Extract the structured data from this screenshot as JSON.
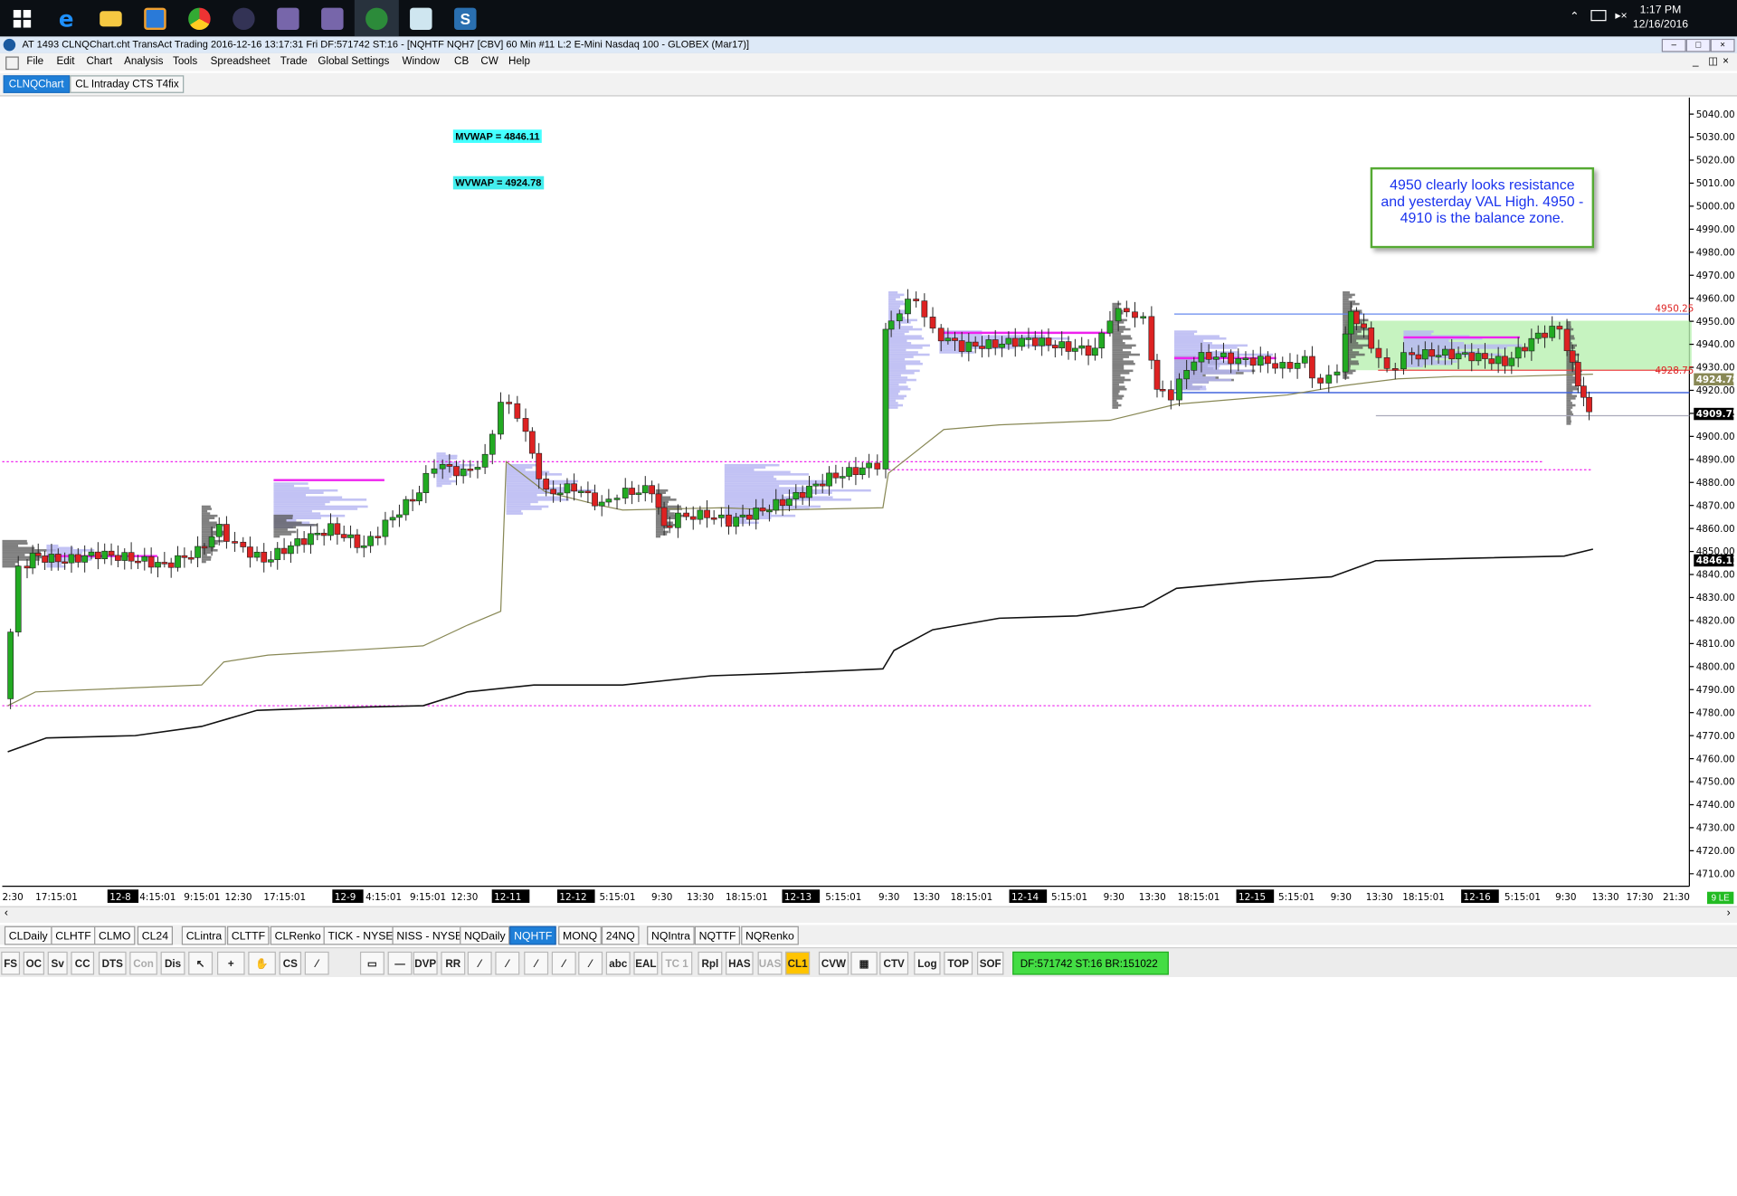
{
  "taskbar": {
    "clock_time": "1:17 PM",
    "clock_date": "12/16/2016",
    "apps": [
      "start-icon",
      "edge-icon",
      "explorer-icon",
      "app-icon",
      "chrome-icon",
      "app-icon",
      "app-icon",
      "app-icon",
      "globe-icon",
      "notes-icon",
      "s-icon"
    ]
  },
  "titlebar": {
    "text": "AT 1493 CLNQChart.cht  TransAct Trading 2016-12-16  13:17:31 Fri  DF:571742  ST:16 - [NQHTF  NQH7 [CBV]  60 Min   #11  L:2  E-Mini Nasdaq 100 - GLOBEX (Mar17)]"
  },
  "menu": [
    "File",
    "Edit",
    "Chart",
    "Analysis",
    "Tools",
    "Spreadsheet",
    "Trade",
    "Global Settings",
    "Window",
    "CB",
    "CW",
    "Help"
  ],
  "chart_tabs": [
    {
      "label": "CLNQChart",
      "active": true
    },
    {
      "label": "CL Intraday CTS T4fix",
      "active": false
    }
  ],
  "chart_labels": {
    "mvwap": "MVWAP =  4846.11",
    "wvwap": "WVWAP =  4924.78",
    "annotation": "4950 clearly looks resistance and yesterday VAL High. 4950 - 4910 is the balance zone.",
    "level_high": "4950.25",
    "level_low": "4928.75",
    "price_wvwap": "4924.78",
    "price_last": "4909.75",
    "price_mvwap": "4846.11"
  },
  "price_axis": [
    "5040.00",
    "5030.00",
    "5020.00",
    "5010.00",
    "5000.00",
    "4990.00",
    "4980.00",
    "4970.00",
    "4960.00",
    "4950.00",
    "4940.00",
    "4930.00",
    "4920.00",
    "4910.00",
    "4900.00",
    "4890.00",
    "4880.00",
    "4870.00",
    "4860.00",
    "4850.00",
    "4840.00",
    "4830.00",
    "4820.00",
    "4810.00",
    "4800.00",
    "4790.00",
    "4780.00",
    "4770.00",
    "4760.00",
    "4750.00",
    "4740.00",
    "4730.00",
    "4720.00",
    "4710.00"
  ],
  "time_axis": [
    {
      "t": "2:30",
      "box": false
    },
    {
      "t": "17:15:01",
      "box": false
    },
    {
      "t": "12-8",
      "box": true
    },
    {
      "t": "4:15:01",
      "box": false
    },
    {
      "t": "9:15:01",
      "box": false
    },
    {
      "t": "12:30",
      "box": false
    },
    {
      "t": "17:15:01",
      "box": false
    },
    {
      "t": "12-9",
      "box": true
    },
    {
      "t": "4:15:01",
      "box": false
    },
    {
      "t": "9:15:01",
      "box": false
    },
    {
      "t": "12:30",
      "box": false
    },
    {
      "t": "12-11",
      "box": true
    },
    {
      "t": "12-12",
      "box": true
    },
    {
      "t": "5:15:01",
      "box": false
    },
    {
      "t": "9:30",
      "box": false
    },
    {
      "t": "13:30",
      "box": false
    },
    {
      "t": "18:15:01",
      "box": false
    },
    {
      "t": "12-13",
      "box": true
    },
    {
      "t": "5:15:01",
      "box": false
    },
    {
      "t": "9:30",
      "box": false
    },
    {
      "t": "13:30",
      "box": false
    },
    {
      "t": "18:15:01",
      "box": false
    },
    {
      "t": "12-14",
      "box": true
    },
    {
      "t": "5:15:01",
      "box": false
    },
    {
      "t": "9:30",
      "box": false
    },
    {
      "t": "13:30",
      "box": false
    },
    {
      "t": "18:15:01",
      "box": false
    },
    {
      "t": "12-15",
      "box": true
    },
    {
      "t": "5:15:01",
      "box": false
    },
    {
      "t": "9:30",
      "box": false
    },
    {
      "t": "13:30",
      "box": false
    },
    {
      "t": "18:15:01",
      "box": false
    },
    {
      "t": "12-16",
      "box": true
    },
    {
      "t": "5:15:01",
      "box": false
    },
    {
      "t": "9:30",
      "box": false
    },
    {
      "t": "13:30",
      "box": false
    },
    {
      "t": "17:30",
      "box": false
    },
    {
      "t": "21:30",
      "box": false
    }
  ],
  "symbol_tabs": [
    "CLDaily",
    "CLHTF",
    "CLMO",
    "CL24",
    "CLintra",
    "CLTTF",
    "CLRenko",
    "TICK - NYSE",
    "NISS - NYSE",
    "NQDaily",
    "NQHTF",
    "MONQ",
    "24NQ",
    "NQIntra",
    "NQTTF",
    "NQRenko"
  ],
  "active_symbol_tab": "NQHTF",
  "toolbar": [
    "FS",
    "OC",
    "Sv",
    "CC",
    "DTS",
    "Con",
    "Dis",
    "cursor-icon",
    "crosshair-icon",
    "hand-icon",
    "CS",
    "trendline-icon",
    "rect-icon",
    "hline-icon",
    "DVP",
    "RR",
    "line-icon",
    "line-icon",
    "line-icon",
    "line-icon",
    "line-icon",
    "abc",
    "EAL",
    "TC 1",
    "Rpl",
    "HAS",
    "UAS",
    "CL1",
    "CVW",
    "grid-icon",
    "CTV",
    "Log",
    "TOP",
    "SOF"
  ],
  "status": "DF:571742  ST:16  BR:151022",
  "corner_label": "9 LE",
  "colors": {
    "up_candle": "#22aa22",
    "down_candle": "#dd2222",
    "magenta": "#ee22ee",
    "blue_line": "#6688ee",
    "green_zone": "#b8f0b0",
    "olive": "#888855",
    "vwap_black": "#111111",
    "annot_border": "#55aa33",
    "annot_text": "#1a33ee",
    "mvwap_bg": "#44ffff",
    "wvwap_bg": "#44eeee"
  },
  "chart_data": {
    "type": "candlestick",
    "ylim": [
      4706,
      5046
    ],
    "y_ticks": [
      5040,
      5030,
      5020,
      5010,
      5000,
      4990,
      4980,
      4970,
      4960,
      4950,
      4940,
      4930,
      4920,
      4910,
      4900,
      4890,
      4880,
      4870,
      4860,
      4850,
      4840,
      4830,
      4820,
      4810,
      4800,
      4790,
      4780,
      4770,
      4760,
      4750,
      4740,
      4730,
      4720,
      4710
    ],
    "levels": {
      "resistance": 4950.25,
      "val": 4928.75,
      "wvwap": 4924.78,
      "last": 4909.75,
      "mvwap": 4846.11,
      "magenta_dashed": [
        4890,
        4886,
        4783
      ],
      "balance_zone": [
        4910,
        4950
      ]
    }
  }
}
